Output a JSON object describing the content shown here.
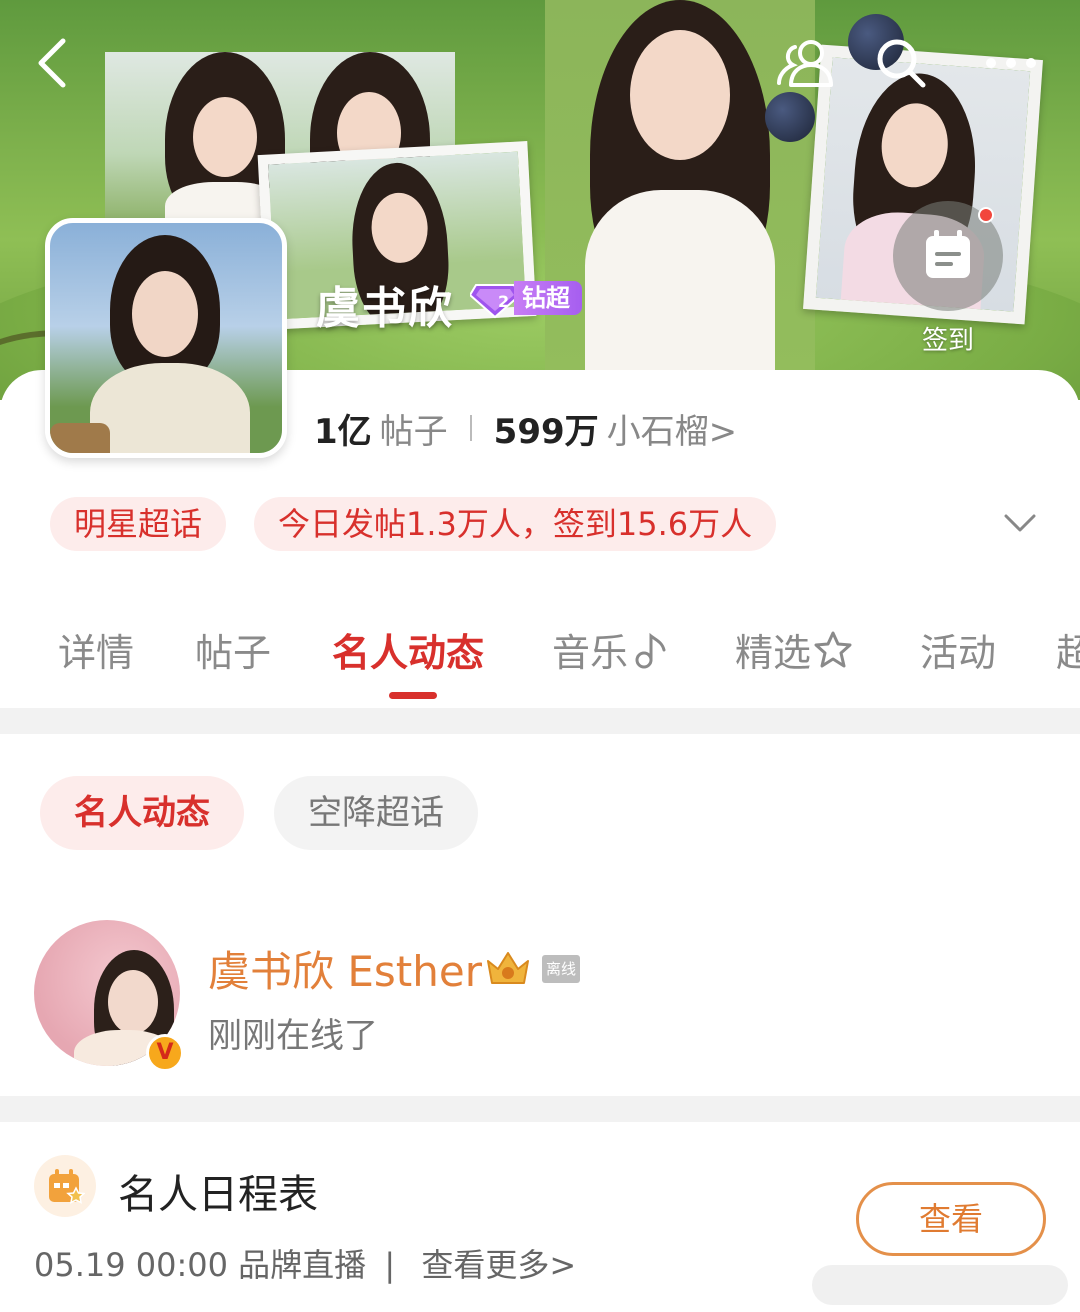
{
  "header": {
    "star_name": "虞书欣",
    "level_badge": "钻超",
    "checkin_label": "签到"
  },
  "stats": {
    "posts_count": "1亿",
    "posts_label": "帖子",
    "fans_count": "599万",
    "fans_label": "小石榴>"
  },
  "tags": {
    "category": "明星超话",
    "activity": "今日发帖1.3万人，签到15.6万人"
  },
  "tabs": [
    {
      "label": "详情"
    },
    {
      "label": "帖子"
    },
    {
      "label": "名人动态"
    },
    {
      "label": "音乐"
    },
    {
      "label": "精选"
    },
    {
      "label": "活动"
    },
    {
      "label": "超"
    }
  ],
  "subtabs": [
    {
      "label": "名人动态"
    },
    {
      "label": "空降超话"
    }
  ],
  "celebrity": {
    "name": "虞书欣 Esther",
    "offline_badge": "离线",
    "status": "刚刚在线了",
    "verified_mark": "V"
  },
  "schedule": {
    "title": "名人日程表",
    "datetime": "05.19 00:00",
    "event": "品牌直播",
    "separator": "|",
    "more_link": "查看更多>",
    "view_button": "查看"
  },
  "colors": {
    "accent": "#d8302c",
    "accent_bg": "#fdeceb",
    "celeb_name": "#e2803a",
    "view_button": "#e07b31"
  }
}
